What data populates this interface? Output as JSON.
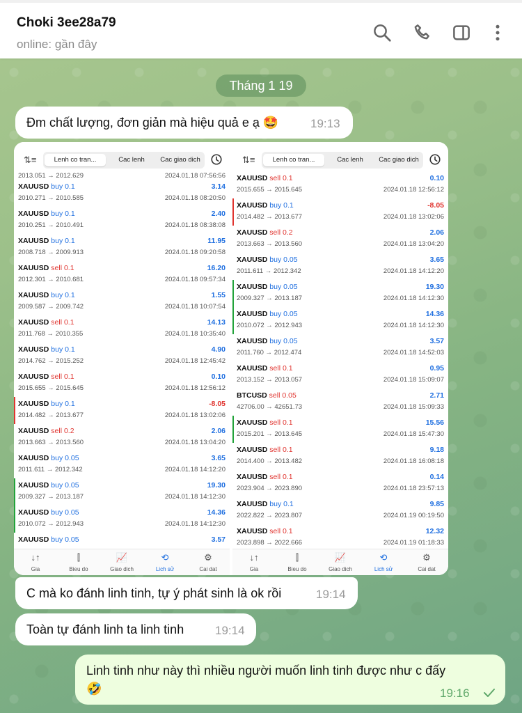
{
  "header": {
    "name": "Choki 3ee28a79",
    "status": "online: gần đây",
    "icons": [
      "search-icon",
      "phone-icon",
      "sidebar-toggle-icon",
      "more-vert-icon"
    ]
  },
  "date_separator": "Tháng 1 19",
  "messages": [
    {
      "text": "Đm chất lượng, đơn giản mà hiệu quả e ạ 🤩",
      "time": "19:13"
    },
    {
      "text": "C mà ko đánh linh tinh, tự ý phát sinh là ok rồi",
      "time": "19:14"
    },
    {
      "text": "Toàn tự đánh linh ta linh tinh",
      "time": "19:14"
    },
    {
      "text": "Linh tinh như này thì nhiều người muốn linh tinh được như c đấy",
      "emoji": "🤣",
      "time": "19:16"
    }
  ],
  "photo": {
    "tabs": [
      "Lenh co tran...",
      "Cac lenh",
      "Cac giao dich"
    ],
    "nav": [
      "Gia",
      "Bieu do",
      "Giao dich",
      "Lich sử",
      "Cai dat"
    ],
    "colors": {
      "buy": "#1f6fe0",
      "sell": "#e0342f",
      "bar_green": "#22a33a",
      "bar_red": "#e0342f"
    },
    "left": {
      "partial_top": {
        "px": "2013.051 → 2012.629",
        "dt": "2024.01.18 07:56:56"
      },
      "trades": [
        {
          "sym": "XAUUSD",
          "side": "buy 0.1",
          "type": "buy",
          "pl": "3.14",
          "px": "2010.271 → 2010.585",
          "dt": "2024.01.18 08:20:50",
          "bar": ""
        },
        {
          "sym": "XAUUSD",
          "side": "buy 0.1",
          "type": "buy",
          "pl": "2.40",
          "px": "2010.251 → 2010.491",
          "dt": "2024.01.18 08:38:08",
          "bar": ""
        },
        {
          "sym": "XAUUSD",
          "side": "buy 0.1",
          "type": "buy",
          "pl": "11.95",
          "px": "2008.718 → 2009.913",
          "dt": "2024.01.18 09:20:58",
          "bar": ""
        },
        {
          "sym": "XAUUSD",
          "side": "sell 0.1",
          "type": "sell",
          "pl": "16.20",
          "px": "2012.301 → 2010.681",
          "dt": "2024.01.18 09:57:34",
          "bar": ""
        },
        {
          "sym": "XAUUSD",
          "side": "buy 0.1",
          "type": "buy",
          "pl": "1.55",
          "px": "2009.587 → 2009.742",
          "dt": "2024.01.18 10:07:54",
          "bar": ""
        },
        {
          "sym": "XAUUSD",
          "side": "sell 0.1",
          "type": "sell",
          "pl": "14.13",
          "px": "2011.768 → 2010.355",
          "dt": "2024.01.18 10:35:40",
          "bar": ""
        },
        {
          "sym": "XAUUSD",
          "side": "buy 0.1",
          "type": "buy",
          "pl": "4.90",
          "px": "2014.762 → 2015.252",
          "dt": "2024.01.18 12:45:42",
          "bar": ""
        },
        {
          "sym": "XAUUSD",
          "side": "sell 0.1",
          "type": "sell",
          "pl": "0.10",
          "px": "2015.655 → 2015.645",
          "dt": "2024.01.18 12:56:12",
          "bar": ""
        },
        {
          "sym": "XAUUSD",
          "side": "buy 0.1",
          "type": "buy",
          "pl": "-8.05",
          "px": "2014.482 → 2013.677",
          "dt": "2024.01.18 13:02:06",
          "bar": "red"
        },
        {
          "sym": "XAUUSD",
          "side": "sell 0.2",
          "type": "sell",
          "pl": "2.06",
          "px": "2013.663 → 2013.560",
          "dt": "2024.01.18 13:04:20",
          "bar": ""
        },
        {
          "sym": "XAUUSD",
          "side": "buy 0.05",
          "type": "buy",
          "pl": "3.65",
          "px": "2011.611 → 2012.342",
          "dt": "2024.01.18 14:12:20",
          "bar": ""
        },
        {
          "sym": "XAUUSD",
          "side": "buy 0.05",
          "type": "buy",
          "pl": "19.30",
          "px": "2009.327 → 2013.187",
          "dt": "2024.01.18 14:12:30",
          "bar": "green"
        },
        {
          "sym": "XAUUSD",
          "side": "buy 0.05",
          "type": "buy",
          "pl": "14.36",
          "px": "2010.072 → 2012.943",
          "dt": "2024.01.18 14:12:30",
          "bar": "green"
        },
        {
          "sym": "XAUUSD",
          "side": "buy 0.05",
          "type": "buy",
          "pl": "3.57",
          "px": "",
          "dt": "",
          "bar": ""
        }
      ]
    },
    "right": {
      "trades": [
        {
          "sym": "XAUUSD",
          "side": "sell 0.1",
          "type": "sell",
          "pl": "0.10",
          "px": "2015.655 → 2015.645",
          "dt": "2024.01.18 12:56:12",
          "bar": ""
        },
        {
          "sym": "XAUUSD",
          "side": "buy 0.1",
          "type": "buy",
          "pl": "-8.05",
          "px": "2014.482 → 2013.677",
          "dt": "2024.01.18 13:02:06",
          "bar": "red"
        },
        {
          "sym": "XAUUSD",
          "side": "sell 0.2",
          "type": "sell",
          "pl": "2.06",
          "px": "2013.663 → 2013.560",
          "dt": "2024.01.18 13:04:20",
          "bar": ""
        },
        {
          "sym": "XAUUSD",
          "side": "buy 0.05",
          "type": "buy",
          "pl": "3.65",
          "px": "2011.611 → 2012.342",
          "dt": "2024.01.18 14:12:20",
          "bar": ""
        },
        {
          "sym": "XAUUSD",
          "side": "buy 0.05",
          "type": "buy",
          "pl": "19.30",
          "px": "2009.327 → 2013.187",
          "dt": "2024.01.18 14:12:30",
          "bar": "green"
        },
        {
          "sym": "XAUUSD",
          "side": "buy 0.05",
          "type": "buy",
          "pl": "14.36",
          "px": "2010.072 → 2012.943",
          "dt": "2024.01.18 14:12:30",
          "bar": "green"
        },
        {
          "sym": "XAUUSD",
          "side": "buy 0.05",
          "type": "buy",
          "pl": "3.57",
          "px": "2011.760 → 2012.474",
          "dt": "2024.01.18 14:52:03",
          "bar": ""
        },
        {
          "sym": "XAUUSD",
          "side": "sell 0.1",
          "type": "sell",
          "pl": "0.95",
          "px": "2013.152 → 2013.057",
          "dt": "2024.01.18 15:09:07",
          "bar": ""
        },
        {
          "sym": "BTCUSD",
          "side": "sell 0.05",
          "type": "sell",
          "pl": "2.71",
          "px": "42706.00 → 42651.73",
          "dt": "2024.01.18 15:09:33",
          "bar": ""
        },
        {
          "sym": "XAUUSD",
          "side": "sell 0.1",
          "type": "sell",
          "pl": "15.56",
          "px": "2015.201 → 2013.645",
          "dt": "2024.01.18 15:47:30",
          "bar": "green"
        },
        {
          "sym": "XAUUSD",
          "side": "sell 0.1",
          "type": "sell",
          "pl": "9.18",
          "px": "2014.400 → 2013.482",
          "dt": "2024.01.18 16:08:18",
          "bar": ""
        },
        {
          "sym": "XAUUSD",
          "side": "sell 0.1",
          "type": "sell",
          "pl": "0.14",
          "px": "2023.904 → 2023.890",
          "dt": "2024.01.18 23:57:13",
          "bar": ""
        },
        {
          "sym": "XAUUSD",
          "side": "buy 0.1",
          "type": "buy",
          "pl": "9.85",
          "px": "2022.822 → 2023.807",
          "dt": "2024.01.19 00:19:50",
          "bar": ""
        },
        {
          "sym": "XAUUSD",
          "side": "sell 0.1",
          "type": "sell",
          "pl": "12.32",
          "px": "2023.898 → 2022.666",
          "dt": "2024.01.19 01:18:33",
          "bar": ""
        }
      ]
    }
  }
}
